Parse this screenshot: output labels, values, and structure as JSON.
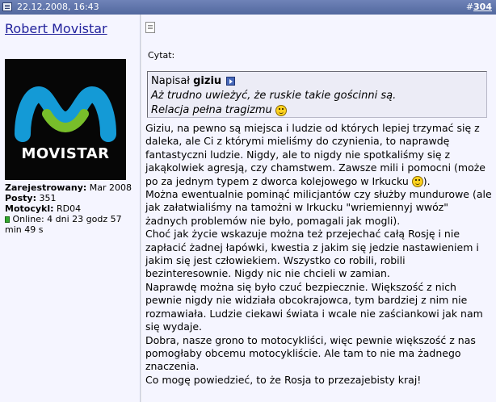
{
  "post_header": {
    "date": "22.12.2008, 16:43",
    "post_number_prefix": "#",
    "post_number": "304"
  },
  "user": {
    "name": "Robert Movistar",
    "avatar_text": "movistar",
    "registered_label": "Zarejestrowany:",
    "registered_value": " Mar 2008",
    "posts_label": "Posty:",
    "posts_value": " 351",
    "motorcycle_label": "Motocykl:",
    "motorcycle_value": " RD04",
    "online_text": " Online: 4 dni 23 godz 57 min 49 s"
  },
  "post": {
    "quote_label": "Cytat:",
    "quote_author_prefix": "Napisał ",
    "quote_author": "giziu",
    "quote_line1": "Aż trudno uwieżyć, że ruskie takie gościnni są.",
    "quote_line2": "Relacja pełna tragizmu ",
    "paragraphs": [
      "Giziu, na pewno są miejsca i ludzie od których lepiej trzymać się z daleka, ale Ci z którymi mieliśmy do czynienia, to naprawdę fantastyczni ludzie. Nigdy, ale to nigdy nie spotkaliśmy się z jakąkolwiek agresją, czy chamstwem. Zawsze mili i pomocni (może po za jednym typem z dworca kolejowego w Irkucku ",
      "Można ewentualnie pominąć milicjantów czy służby mundurowe (ale jak załatwialiśmy na tamożni w Irkucku \"wriemiennyj wwóz\" żadnych problemów nie było, pomagali jak mogli).",
      "Choć jak życie wskazuje można też przejechać całą Rosję i nie zapłacić żadnej łapówki, kwestia z jakim się jedzie nastawieniem i jakim się jest człowiekiem. Wszystko co robili, robili bezinteresownie. Nigdy nic nie chcieli w zamian.",
      "Naprawdę można się było czuć bezpiecznie. Większość z nich pewnie nigdy nie widziała obcokrajowca, tym bardziej z nim nie rozmawiała. Ludzie ciekawi świata i wcale nie zaściankowi jak nam się wydaje.",
      "Dobra, nasze grono to motocykliści, więc pewnie większość z nas pomogłaby obcemu motocykliście. Ale tam to nie ma żadnego znaczenia.",
      "Co mogę powiedzieć, to że Rosja to przezajebisty kraj!"
    ],
    "paragraph1_suffix": ")."
  },
  "icons": {
    "post": "post-icon",
    "document": "document-icon",
    "view_post": "view-post-icon",
    "smiley": "smiley-icon",
    "online": "online-status-icon"
  },
  "colors": {
    "header_bar": "#5f75ad",
    "username": "#22229c",
    "panel_bg": "#f5f5ff",
    "quote_bg": "#ececf6",
    "avatar_bg": "#060606",
    "logo_blue": "#149ad6",
    "logo_green": "#78be2a"
  }
}
